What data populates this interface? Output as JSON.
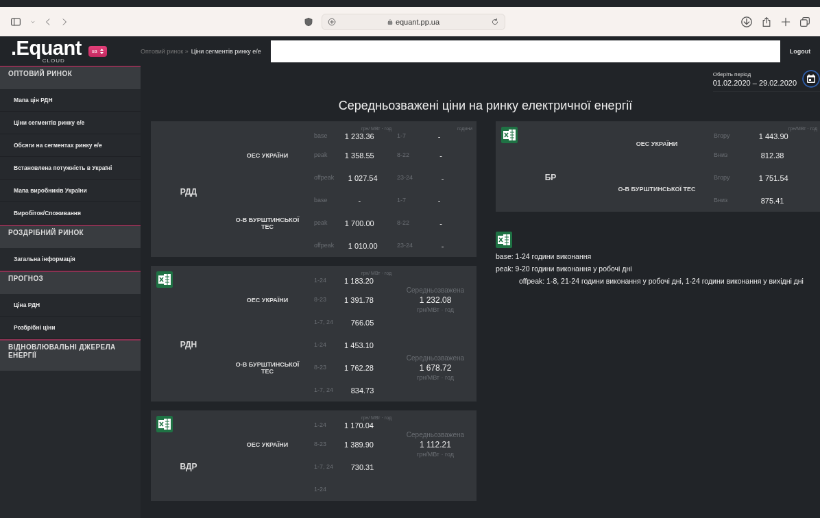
{
  "browser": {
    "url": "equant.pp.ua"
  },
  "header": {
    "logo": ".Equant",
    "logo_sub": "CLOUD",
    "language": "ua",
    "breadcrumb": [
      {
        "label": "Оптовий ринок »",
        "current": false
      },
      {
        "label": "Ціни сегментів ринку е/е",
        "current": true
      }
    ],
    "logout": "Logout"
  },
  "sidebar": {
    "sections": [
      {
        "title": "ОПТОВИЙ РИНОК",
        "items": [
          "Мапа цін РДН",
          "Ціни сегментів ринку е/е",
          "Обсяги на сегментах ринку е/е",
          "Встановлена потужність в Україні",
          "Мапа виробників України",
          "Виробіток/Споживання"
        ]
      },
      {
        "title": "РОЗДРІБНИЙ РИНОК",
        "items": [
          "Загальна інформація"
        ]
      },
      {
        "title": "ПРОГНОЗ",
        "items": [
          "Ціна РДН",
          "Розбрібні ціни"
        ]
      },
      {
        "title": "ВІДНОВЛЮВАЛЬНІ ДЖЕРЕЛА ЕНЕРГІЇ"
      }
    ]
  },
  "period": {
    "label": "Оберіть період",
    "value": "01.02.2020 – 29.02.2020"
  },
  "title": "Середньозважені ціни на ринку електричної енергії",
  "cards_left": [
    {
      "kind": "hours",
      "segment": "РДД",
      "export_icon": false,
      "unit": "грн/ МВт · год",
      "hours_header": "години",
      "zones": [
        {
          "name": "ОЕС УКРАЇНИ",
          "rows": [
            {
              "label": "base",
              "value": "1 233.36",
              "hours": "1-7",
              "hours_value": "-"
            },
            {
              "label": "peak",
              "value": "1 358.55",
              "hours": "8-22",
              "hours_value": "-"
            },
            {
              "label": "offpeak",
              "value": "1 027.54",
              "hours": "23-24",
              "hours_value": "-"
            }
          ]
        },
        {
          "name": "О-В БУРШТИНСЬКОЇ ТЕС",
          "rows": [
            {
              "label": "base",
              "value": "-",
              "hours": "1-7",
              "hours_value": "-"
            },
            {
              "label": "peak",
              "value": "1 700.00",
              "hours": "8-22",
              "hours_value": "-"
            },
            {
              "label": "offpeak",
              "value": "1 010.00",
              "hours": "23-24",
              "hours_value": "-"
            }
          ]
        }
      ]
    },
    {
      "kind": "average",
      "segment": "РДН",
      "export_icon": true,
      "unit": "грн/ МВт · год",
      "zones": [
        {
          "name": "ОЕС УКРАЇНИ",
          "rows": [
            {
              "label": "1-24",
              "value": "1 183.20"
            },
            {
              "label": "8-23",
              "value": "1 391.78"
            },
            {
              "label": "1-7, 24",
              "value": "766.05"
            }
          ],
          "average": {
            "label": "Середньозважена",
            "value": "1 232.08",
            "unit": "грн/МВт · год"
          }
        },
        {
          "name": "О-В БУРШТИНСЬКОЇ ТЕС",
          "rows": [
            {
              "label": "1-24",
              "value": "1 453.10"
            },
            {
              "label": "8-23",
              "value": "1 762.28"
            },
            {
              "label": "1-7, 24",
              "value": "834.73"
            }
          ],
          "average": {
            "label": "Середньозважена",
            "value": "1 678.72",
            "unit": "грн/МВт · год"
          }
        }
      ]
    },
    {
      "kind": "average",
      "segment": "ВДР",
      "export_icon": true,
      "unit": "грн/ МВт · год",
      "zones": [
        {
          "name": "ОЕС УКРАЇНИ",
          "rows": [
            {
              "label": "1-24",
              "value": "1 170.04"
            },
            {
              "label": "8-23",
              "value": "1 389.90"
            },
            {
              "label": "1-7, 24",
              "value": "730.31"
            }
          ],
          "average": {
            "label": "Середньозважена",
            "value": "1 112.21",
            "unit": "грн/МВт · год"
          }
        },
        {
          "rows": [
            {
              "label": "1-24"
            }
          ]
        }
      ]
    }
  ],
  "cards_right": [
    {
      "kind": "balancing",
      "segment": "БР",
      "export_icon": true,
      "unit": "грн/МВт · год",
      "zones": [
        {
          "name": "ОЕС УКРАЇНИ",
          "rows": [
            {
              "label": "Вгору",
              "value": "1 443.90"
            },
            {
              "label": "Вниз",
              "value": "812.38"
            }
          ]
        },
        {
          "name": "О-В БУРШТИНСЬКОЇ ТЕС",
          "rows": [
            {
              "label": "Вгору",
              "value": "1 751.54"
            },
            {
              "label": "Вниз",
              "value": "875.41"
            }
          ]
        }
      ]
    }
  ],
  "legend": {
    "export_icon": true,
    "lines": [
      "base: 1-24 години виконання",
      "peak: 9-20 години виконання у робочі дні",
      "offpeak: 1-8, 21-24 години виконання у робочі дні, 1-24 години виконання у вихідні дні"
    ]
  }
}
